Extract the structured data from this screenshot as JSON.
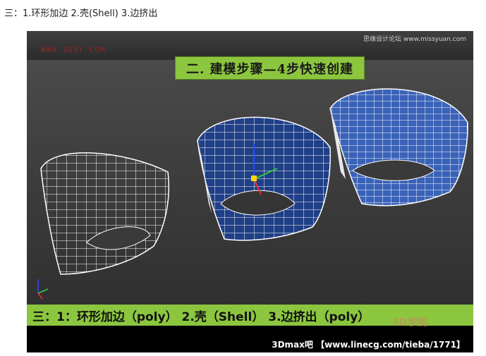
{
  "page": {
    "caption": "三：1.环形加边 2.壳(Shell) 3.边挤出"
  },
  "image": {
    "watermark": "WWW.3DXY.COM",
    "brand": "思缘设计论坛 www.missyuan.com",
    "title": "二. 建模步骤—4步快速创建",
    "step_text": "三：1：环形加边（poly） 2.壳（Shell） 3.边挤出（poly）",
    "footer": "3Dmax吧 【www.linecg.com/tieba/1771】",
    "stamp": "3D学院"
  },
  "colors": {
    "banner_green": "#8cc63f",
    "mesh_blue": "#1f3f86",
    "wire_white": "#ffffff",
    "background": "#404040"
  }
}
